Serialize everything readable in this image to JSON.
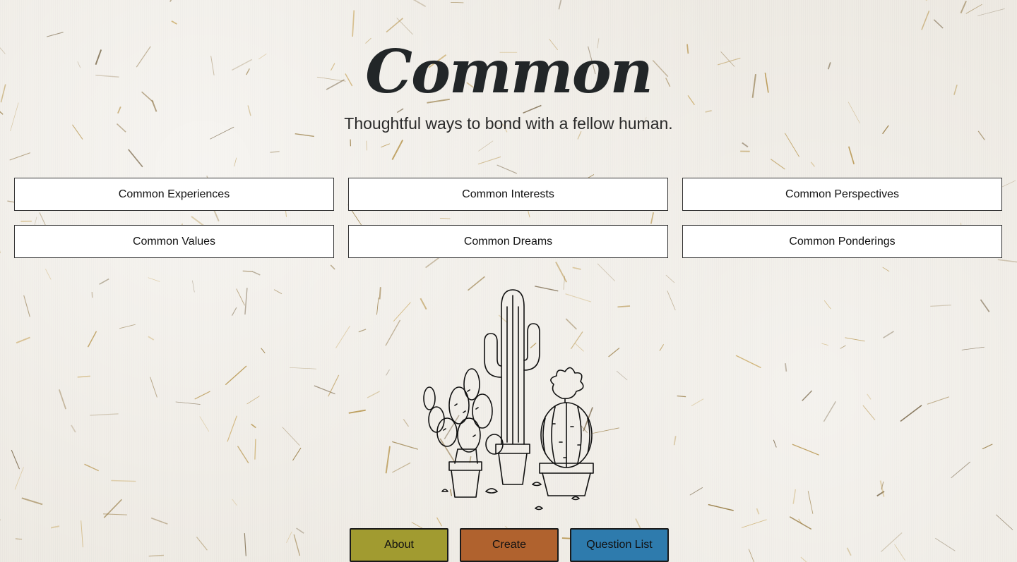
{
  "header": {
    "logo": "Common",
    "tagline": "Thoughtful ways to bond with a fellow human."
  },
  "categories": [
    {
      "label": "Common Experiences"
    },
    {
      "label": "Common Interests"
    },
    {
      "label": "Common Perspectives"
    },
    {
      "label": "Common Values"
    },
    {
      "label": "Common Dreams"
    },
    {
      "label": "Common Ponderings"
    }
  ],
  "illustration": {
    "icon": "cactus-illustration"
  },
  "footer_nav": [
    {
      "label": "About",
      "color": "#a19b30"
    },
    {
      "label": "Create",
      "color": "#b0622e"
    },
    {
      "label": "Question List",
      "color": "#2e7bad"
    }
  ],
  "colors": {
    "background": "#ece8e0",
    "text": "#222628"
  }
}
